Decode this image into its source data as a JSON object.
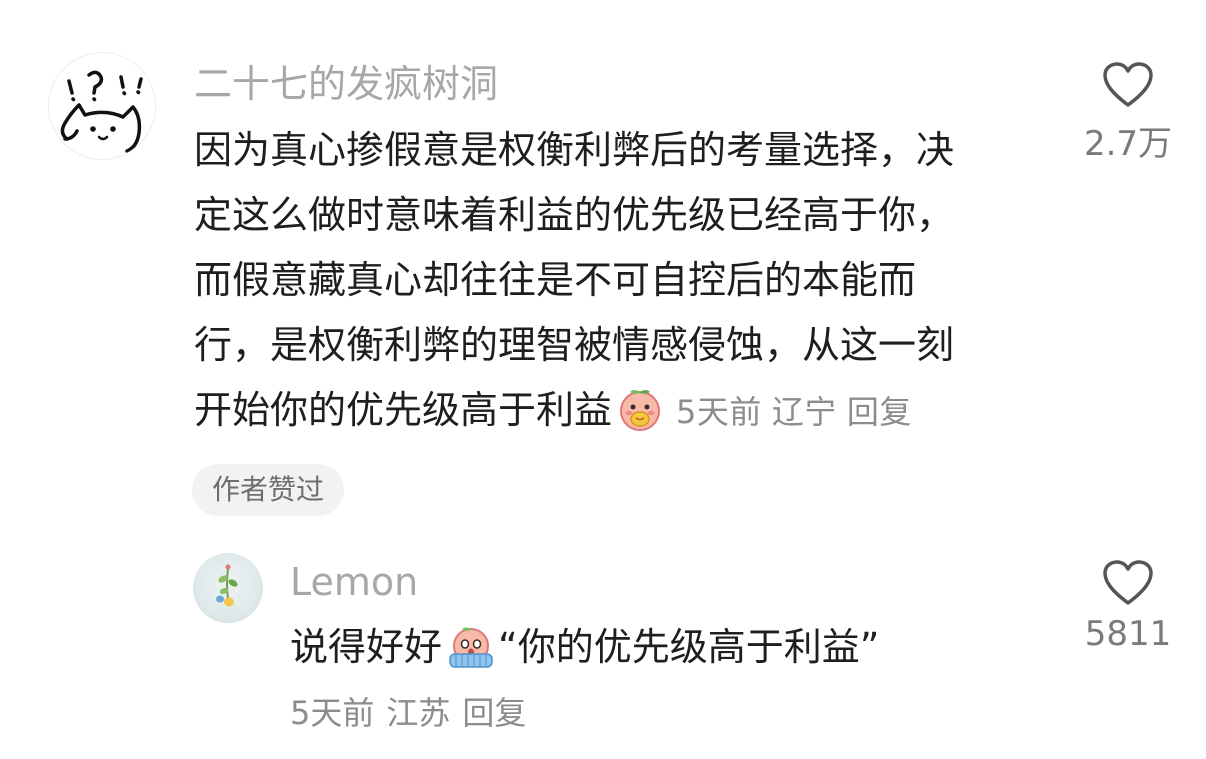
{
  "comment": {
    "username": "二十七的发疯树洞",
    "body_lines": [
      "因为真心掺假意是权衡利弊后的考量选择，决",
      "定这么做时意味着利益的优先级已经高于你，",
      "而假意藏真心却往往是不可自控后的本能而",
      "行，是权衡利弊的理智被情感侵蚀，从这一刻",
      "开始你的优先级高于利益"
    ],
    "time": "5天前",
    "location": "辽宁",
    "reply_label": "回复",
    "like_count": "2.7万",
    "author_liked_badge": "作者赞过",
    "avatar_icon": "doodle-cat-avatar",
    "emoji_icon": "peach-eating-emoji"
  },
  "reply": {
    "username": "Lemon",
    "body_prefix": "说得好好",
    "body_suffix": "“你的优先级高于利益”",
    "time": "5天前",
    "location": "江苏",
    "reply_label": "回复",
    "like_count": "5811",
    "avatar_icon": "plant-avatar",
    "emoji_icon": "peach-covering-face-emoji"
  },
  "colors": {
    "username": "#a7a7a7",
    "body_text": "#1e1e1e",
    "meta_text": "#8c8c8c",
    "badge_bg": "#f2f2f2"
  }
}
